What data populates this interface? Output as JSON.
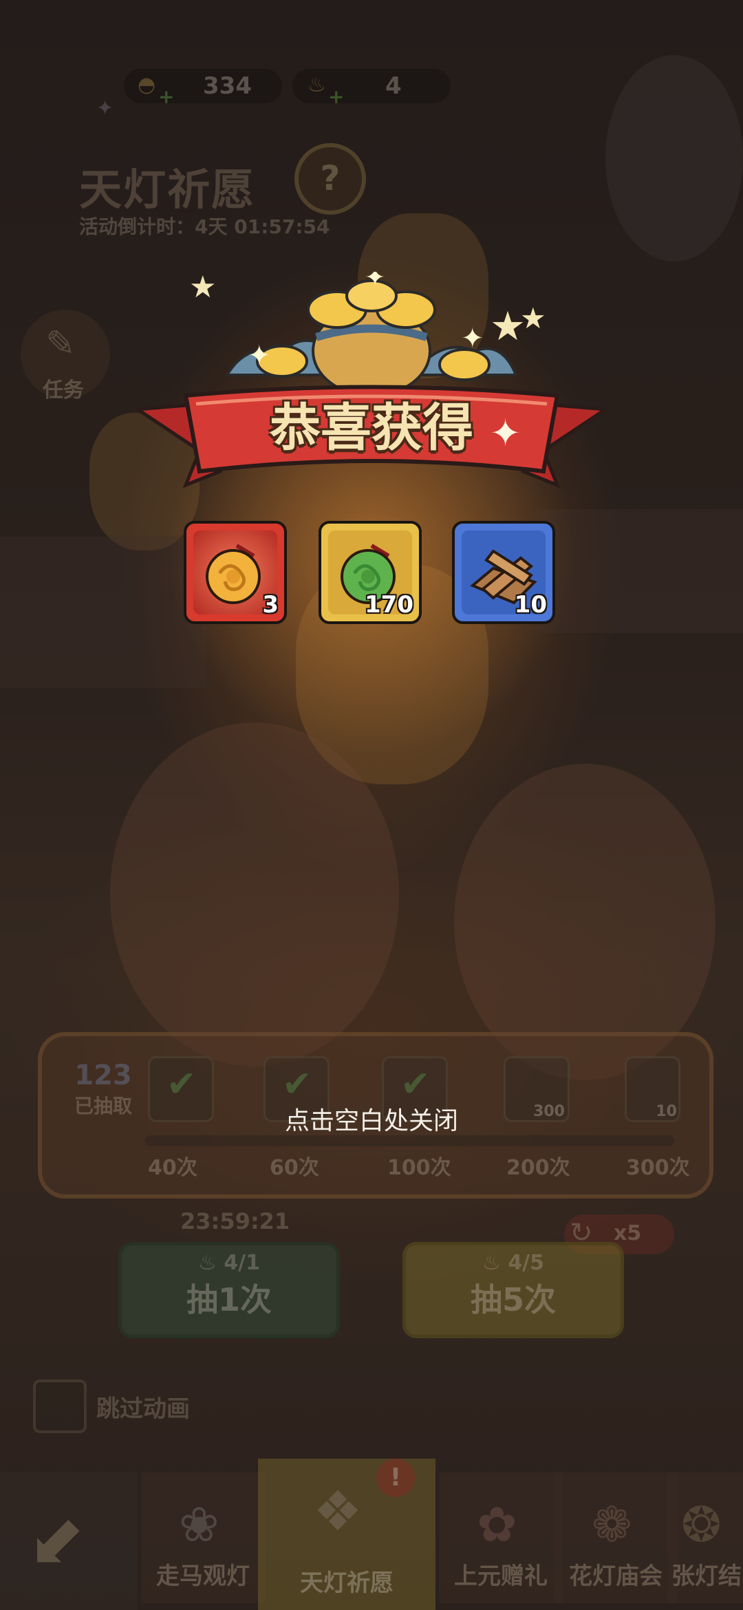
{
  "hud": {
    "gold_value": "334",
    "lamp_value": "4"
  },
  "event": {
    "title": "天灯祈愿",
    "countdown_label": "活动倒计时：",
    "countdown_value": "4天 01:57:54"
  },
  "side": {
    "task_label": "任务"
  },
  "progress": {
    "drawn_count": "123",
    "drawn_label": "已抽取",
    "milestones": [
      "40次",
      "60次",
      "100次",
      "200次",
      "300次"
    ],
    "milestone_badges": [
      "300",
      "10"
    ]
  },
  "draw": {
    "timer": "23:59:21",
    "one_cost": "4/1",
    "one_label": "抽1次",
    "five_cost": "4/5",
    "five_label": "抽5次",
    "multiplier": "x5"
  },
  "skip_animation_label": "跳过动画",
  "bottom_tabs": [
    {
      "label": "走马观灯",
      "icon": "lotus-lantern-icon"
    },
    {
      "label": "天灯祈愿",
      "icon": "sky-lantern-icon"
    },
    {
      "label": "上元赠礼",
      "icon": "gift-flower-icon"
    },
    {
      "label": "花灯庙会",
      "icon": "flower-lantern-icon"
    },
    {
      "label": "张灯结",
      "icon": "hanging-lantern-icon"
    }
  ],
  "popup": {
    "banner_title": "恭喜获得",
    "rewards": [
      {
        "icon": "golden-jade-pendant-icon",
        "count": "3",
        "frame": "#d83a2e"
      },
      {
        "icon": "green-jade-pendant-icon",
        "count": "170",
        "frame": "#e8c04a"
      },
      {
        "icon": "wood-planks-icon",
        "count": "10",
        "frame": "#4d78d8"
      }
    ],
    "close_hint": "点击空白处关闭"
  },
  "colors": {
    "banner_red": "#d63a34",
    "banner_gold": "#f1d08a"
  }
}
